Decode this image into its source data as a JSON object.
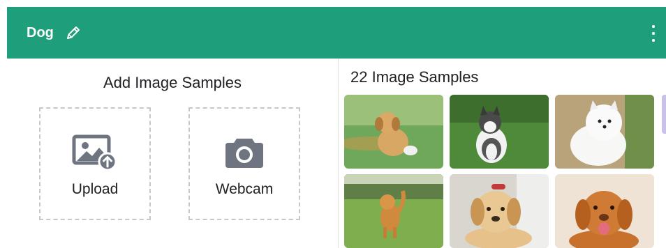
{
  "header": {
    "class_name": "Dog",
    "edit_icon": "pencil-icon",
    "menu_icon": "kebab-menu-icon",
    "color": "#1f9e7c"
  },
  "add_samples": {
    "title": "Add Image Samples",
    "upload_label": "Upload",
    "upload_icon": "image-upload-icon",
    "webcam_label": "Webcam",
    "webcam_icon": "camera-icon"
  },
  "samples": {
    "count_label": "22 Image Samples",
    "thumbnails": [
      "golden-retriever-puppy-on-grass",
      "husky-puppy-on-grass",
      "white-fluffy-puppy",
      "golden-retriever-puppy-running",
      "labrador-puppy-lying",
      "toller-dog-smiling"
    ]
  }
}
